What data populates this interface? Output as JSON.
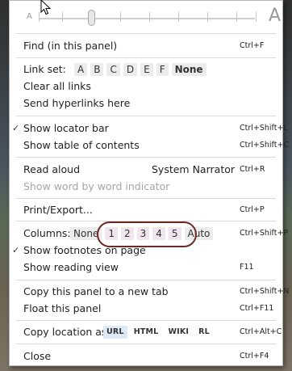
{
  "font_size": {
    "small_glyph": "A",
    "large_glyph": "A",
    "level": 0.27
  },
  "menu": {
    "find": {
      "label": "Find (in this panel)",
      "shortcut": "Ctrl+F"
    },
    "link_set": {
      "label": "Link set:",
      "options": [
        "A",
        "B",
        "C",
        "D",
        "E",
        "F",
        "None"
      ],
      "selected": "None"
    },
    "clear_links": {
      "label": "Clear all links"
    },
    "send_hyperlinks": {
      "label": "Send hyperlinks here"
    },
    "locator_bar": {
      "label": "Show locator bar",
      "shortcut": "Ctrl+Shift+L",
      "checked": true
    },
    "toc": {
      "label": "Show table of contents",
      "shortcut": "Ctrl+Shift+C"
    },
    "read_aloud": {
      "label": "Read aloud",
      "voice": "System Narrator",
      "shortcut": "Ctrl+R"
    },
    "word_indicator": {
      "label": "Show word by word indicator"
    },
    "print": {
      "label": "Print/Export...",
      "shortcut": "Ctrl+P"
    },
    "columns": {
      "label": "Columns:",
      "options": [
        "None",
        "1",
        "2",
        "3",
        "4",
        "5",
        "Auto"
      ],
      "shortcut": "Ctrl+Shift+P"
    },
    "footnotes": {
      "label": "Show footnotes on page",
      "checked": true
    },
    "reading_view": {
      "label": "Show reading view",
      "shortcut": "F11"
    },
    "copy_panel": {
      "label": "Copy this panel to a new tab",
      "shortcut": "Ctrl+Shift+N"
    },
    "float_panel": {
      "label": "Float this panel",
      "shortcut": "Ctrl+F11"
    },
    "copy_location": {
      "label": "Copy location as:",
      "options": [
        "URL",
        "HTML",
        "WIKI",
        "RL"
      ],
      "selected": "URL",
      "shortcut": "Ctrl+Alt+C"
    },
    "close": {
      "label": "Close",
      "shortcut": "Ctrl+F4"
    }
  }
}
